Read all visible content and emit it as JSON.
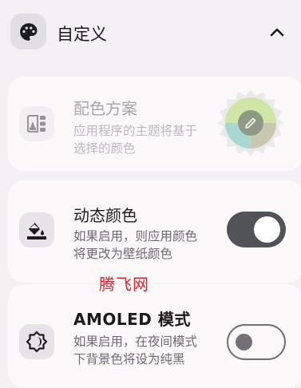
{
  "section": {
    "title": "自定义",
    "icon": "palette-icon",
    "collapse_icon": "chevron-up-icon"
  },
  "color_scheme": {
    "title": "配色方案",
    "description": "应用程序的主题将基于选择的颜色",
    "enabled": false,
    "icon": "wallpaper-palette-icon",
    "preview_icon": "edit-pencil-icon",
    "colors": {
      "primary": "#cfe6a6",
      "secondary": "#a9d8d0",
      "tertiary": "#c9c7b0",
      "accent": "#8f9a86"
    }
  },
  "dynamic_color": {
    "title": "动态颜色",
    "description": "如果启用，则应用颜色将更改为壁纸颜色",
    "on": true,
    "icon": "format-color-fill-icon"
  },
  "amoled": {
    "title": "AMOLED 模式",
    "description": "如果启用，在夜间模式下背景色将设为纯黑",
    "on": false,
    "icon": "brightness-icon"
  },
  "watermark": "腾飞网"
}
